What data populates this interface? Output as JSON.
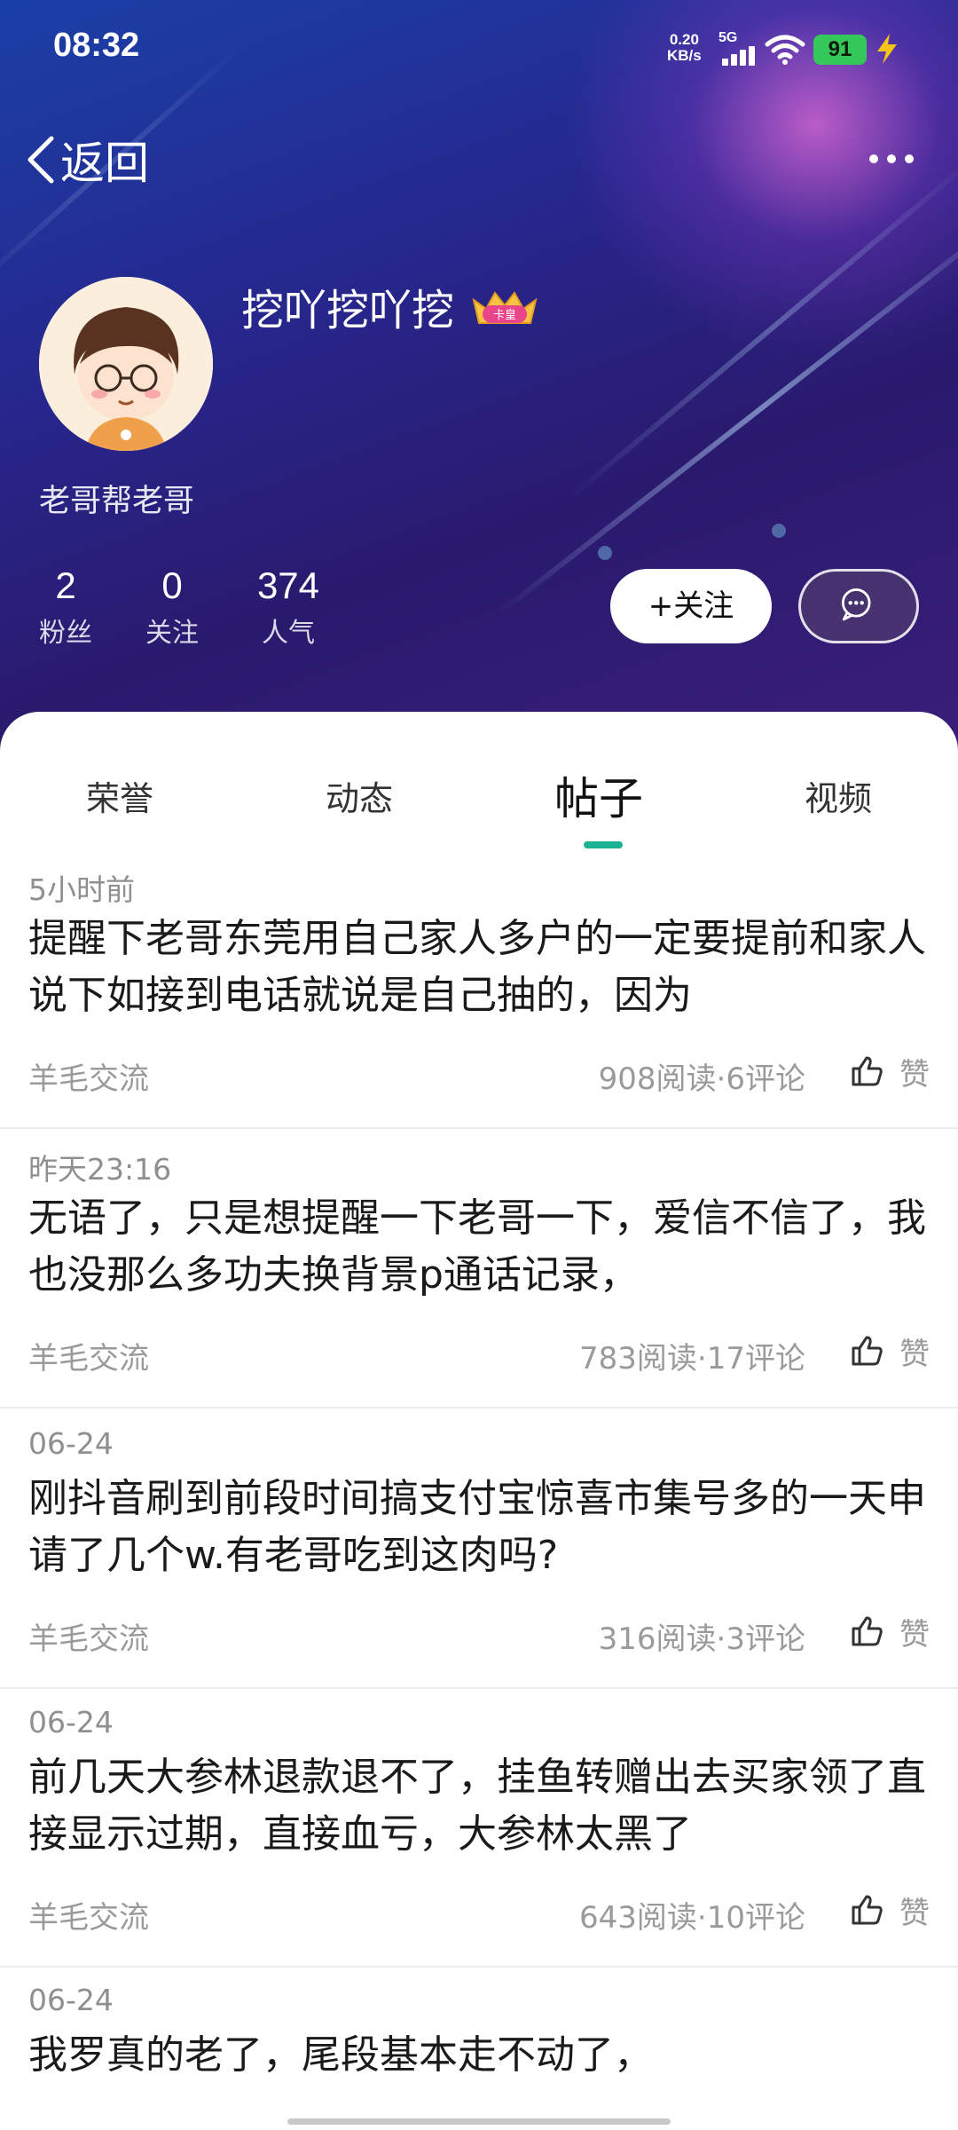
{
  "status_bar": {
    "time": "08:32",
    "speed_value": "0.20",
    "speed_unit": "KB/s",
    "network": "5G",
    "battery": "91",
    "colors": {
      "battery": "#34c759",
      "charging_bolt": "#f5c518"
    }
  },
  "nav": {
    "back_label": "返回",
    "back_icon": "chevron-left-icon",
    "more_icon": "more-dots-icon"
  },
  "profile": {
    "name": "挖吖挖吖挖",
    "badge_text": "卡皇",
    "bio": "老哥帮老哥",
    "stats": [
      {
        "value": "2",
        "label": "粉丝"
      },
      {
        "value": "0",
        "label": "关注"
      },
      {
        "value": "374",
        "label": "人气"
      }
    ],
    "follow_label": "+关注",
    "message_icon": "chat-bubble-icon"
  },
  "tabs": {
    "items": [
      "荣誉",
      "动态",
      "帖子",
      "视频"
    ],
    "active": "帖子",
    "accent_color": "#1ab394"
  },
  "posts": [
    {
      "time": "5小时前",
      "text": "提醒下老哥东莞用自己家人多户的一定要提前和家人说下如接到电话就说是自己抽的，因为",
      "category": "羊毛交流",
      "meta": "908阅读·6评论",
      "like_label": "赞"
    },
    {
      "time": "昨天23:16",
      "text": "无语了，只是想提醒一下老哥一下，爱信不信了，我也没那么多功夫换背景p通话记录，",
      "category": "羊毛交流",
      "meta": "783阅读·17评论",
      "like_label": "赞"
    },
    {
      "time": "06-24",
      "text": "刚抖音刷到前段时间搞支付宝惊喜市集号多的一天申请了几个w.有老哥吃到这肉吗?",
      "category": "羊毛交流",
      "meta": "316阅读·3评论",
      "like_label": "赞"
    },
    {
      "time": "06-24",
      "text": "前几天大参林退款退不了，挂鱼转赠出去买家领了直接显示过期，直接血亏，大参林太黑了",
      "category": "羊毛交流",
      "meta": "643阅读·10评论",
      "like_label": "赞"
    },
    {
      "time": "06-24",
      "text": "我罗真的老了，尾段基本走不动了，"
    }
  ]
}
